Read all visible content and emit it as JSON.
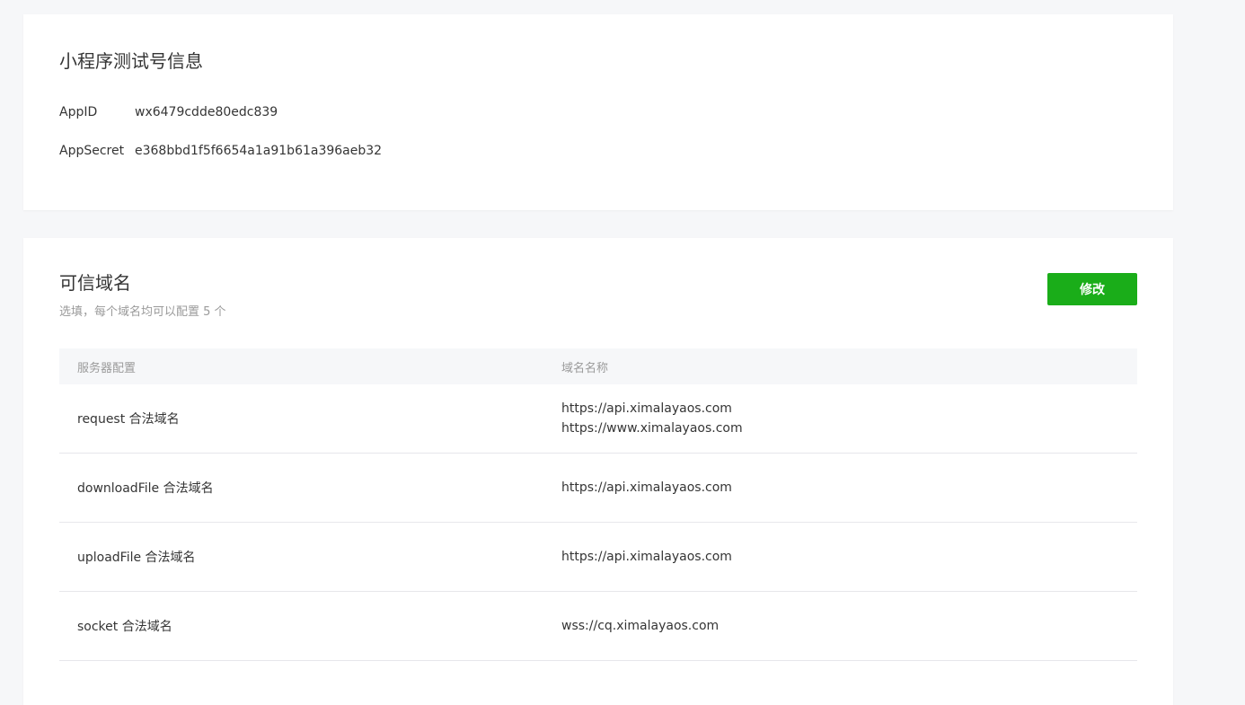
{
  "info_card": {
    "title": "小程序测试号信息",
    "appid_label": "AppID",
    "appid_value": "wx6479cdde80edc839",
    "secret_label": "AppSecret",
    "secret_value": "e368bbd1f5f6654a1a91b61a396aeb32"
  },
  "domain_card": {
    "title": "可信域名",
    "subtitle": "选填，每个域名均可以配置 5 个",
    "edit_label": "修改",
    "header": {
      "col_server": "服务器配置",
      "col_domain": "域名名称"
    },
    "rows": [
      {
        "server": "request 合法域名",
        "domain_1": "https://api.ximalayaos.com",
        "domain_2": "https://www.ximalayaos.com"
      },
      {
        "server": "downloadFile 合法域名",
        "domain_1": "https://api.ximalayaos.com"
      },
      {
        "server": "uploadFile 合法域名",
        "domain_1": "https://api.ximalayaos.com"
      },
      {
        "server": "socket 合法域名",
        "domain_1": "wss://cq.ximalayaos.com"
      }
    ]
  },
  "colors": {
    "accent": "#1aad19",
    "background": "#f6f7f9",
    "card": "#ffffff",
    "muted_text": "#9a9a9a",
    "text": "#353535"
  }
}
